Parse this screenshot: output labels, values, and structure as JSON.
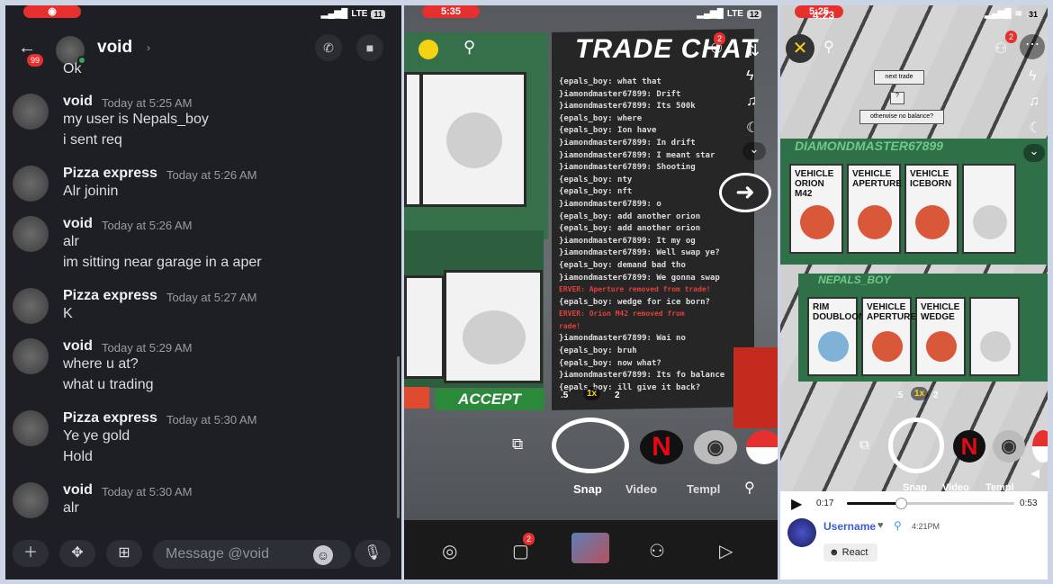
{
  "discord": {
    "status_time": "",
    "carrier": "LTE",
    "battery": "11",
    "back_badge": "99",
    "title": "void",
    "messages": [
      {
        "name": "",
        "time": "",
        "lines": [
          "Ok"
        ]
      },
      {
        "name": "void",
        "time": "Today at 5:25 AM",
        "lines": [
          "my user is Nepals_boy",
          "i  sent req"
        ]
      },
      {
        "name": "Pizza express",
        "time": "Today at 5:26 AM",
        "lines": [
          "Alr joinin"
        ]
      },
      {
        "name": "void",
        "time": "Today at 5:26 AM",
        "lines": [
          "alr",
          "im sitting near garage in a aper"
        ]
      },
      {
        "name": "Pizza express",
        "time": "Today at 5:27 AM",
        "lines": [
          "K"
        ]
      },
      {
        "name": "void",
        "time": "Today at 5:29 AM",
        "lines": [
          "where u at?",
          "what u trading"
        ]
      },
      {
        "name": "Pizza express",
        "time": "Today at 5:30 AM",
        "lines": [
          "Ye ye gold",
          "Hold"
        ]
      },
      {
        "name": "void",
        "time": "Today at 5:30 AM",
        "lines": [
          "alr"
        ]
      }
    ],
    "input_placeholder": "Message @void"
  },
  "snap": {
    "status_time": "5:35",
    "carrier": "LTE",
    "battery": "12",
    "top_badge": "2",
    "sign": "TRADE CHAT",
    "chat_lines": [
      {
        "t": "{epals_boy: what that",
        "red": false
      },
      {
        "t": "}iamondmaster67899: Drift",
        "red": false
      },
      {
        "t": "}iamondmaster67899: Its 500k",
        "red": false
      },
      {
        "t": "{epals_boy: where",
        "red": false
      },
      {
        "t": "{epals_boy: Ion have",
        "red": false
      },
      {
        "t": "}iamondmaster67899: In drift",
        "red": false
      },
      {
        "t": "}iamondmaster67899: I meant star",
        "red": false
      },
      {
        "t": "}iamondmaster67899: Shooting",
        "red": false
      },
      {
        "t": "{epals_boy: nty",
        "red": false
      },
      {
        "t": "{epals_boy: nft",
        "red": false
      },
      {
        "t": "}iamondmaster67899: o",
        "red": false
      },
      {
        "t": "{epals_boy: add another orion",
        "red": false
      },
      {
        "t": "{epals_boy: add another orion",
        "red": false
      },
      {
        "t": "}iamondmaster67899: It my og",
        "red": false
      },
      {
        "t": "}iamondmaster67899: Well swap ye?",
        "red": false
      },
      {
        "t": "{epals_boy: demand bad  tho",
        "red": false
      },
      {
        "t": "}iamondmaster67899: We gonna swap",
        "red": false
      },
      {
        "t": "ERVER: Aperture removed from trade!",
        "red": true
      },
      {
        "t": "{epals_boy: wedge for ice born?",
        "red": false
      },
      {
        "t": "ERVER: Orion M42 removed from",
        "red": true
      },
      {
        "t": "rade!",
        "red": true
      },
      {
        "t": "}iamondmaster67899: Wai no",
        "red": false
      },
      {
        "t": "{epals_boy: bruh",
        "red": false
      },
      {
        "t": "{epals_boy: now what?",
        "red": false
      },
      {
        "t": "}iamondmaster67899: Its fo balance",
        "red": false
      },
      {
        "t": "{epals_boy: ill give it back?",
        "red": false
      }
    ],
    "accept": "ACCEPT",
    "zoom": [
      ".5",
      "1x",
      "2"
    ],
    "modes": [
      "Snap",
      "Video",
      "Templ"
    ],
    "nav_badge": "2"
  },
  "story": {
    "status_time": "5:25",
    "overlay_time": "4:23",
    "carrier": "",
    "battery": "31",
    "add_badge": "2",
    "sign1": "next trade",
    "sign2": "?",
    "sign3": "otherwise no balance?",
    "player1": "DIAMONDMASTER67899",
    "player2": "NEPALS_BOY",
    "cards_top": [
      {
        "label": "VEHICLE ORION M42",
        "color": "#d9583a"
      },
      {
        "label": "VEHICLE APERTURE",
        "color": "#d9583a"
      },
      {
        "label": "VEHICLE ICEBORN",
        "color": "#d9583a"
      },
      {
        "label": "",
        "color": "#d0d0d0"
      }
    ],
    "cards_bottom": [
      {
        "label": "RIM DOUBLOON",
        "color": "#7fb2d6"
      },
      {
        "label": "VEHICLE APERTURE",
        "color": "#d9583a"
      },
      {
        "label": "VEHICLE WEDGE",
        "color": "#d9583a"
      },
      {
        "label": "",
        "color": "#d0d0d0"
      }
    ],
    "zoom": [
      ".5",
      "1x",
      "2"
    ],
    "elapsed": "0:17",
    "duration": "0:53",
    "progress": 0.32,
    "username": "Username",
    "posted": "4:21PM",
    "react": "React",
    "modes": [
      "Snap",
      "Video",
      "Templ"
    ]
  },
  "colors": {
    "discord_bg": "#1e1f24",
    "snap_red": "#e5302f",
    "accept": "#2a8a3a"
  }
}
